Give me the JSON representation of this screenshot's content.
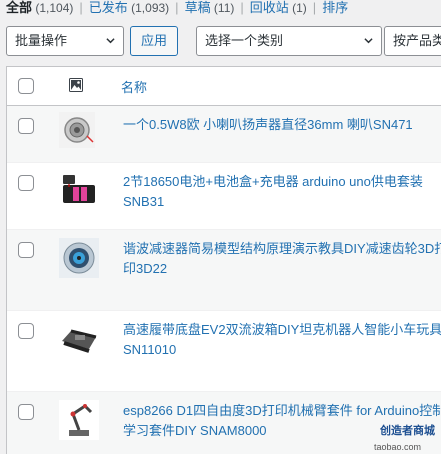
{
  "filters": [
    {
      "label": "全部",
      "count": "(1,104)",
      "current": true
    },
    {
      "label": "已发布",
      "count": "(1,093)",
      "current": false
    },
    {
      "label": "草稿",
      "count": "(11)",
      "current": false
    },
    {
      "label": "回收站",
      "count": "(1)",
      "current": false
    },
    {
      "label": "排序",
      "count": "",
      "current": false
    }
  ],
  "toolbar": {
    "bulk_actions_label": "批量操作",
    "apply_label": "应用",
    "category_label": "选择一个类别",
    "product_type_label": "按产品类"
  },
  "table": {
    "image_header_icon": "image-icon",
    "name_header": "名称"
  },
  "products": [
    {
      "title": "一个0.5W8欧 小喇叭扬声器直径36mm 喇叭SN471",
      "thumb": "speaker-thumbnail"
    },
    {
      "title": "2节18650电池+电池盒+充电器 arduino uno供电套装SNB31",
      "thumb": "battery-thumbnail"
    },
    {
      "title": "谐波减速器简易模型结构原理演示教具DIY减速齿轮3D打印3D22",
      "thumb": "gear-thumbnail"
    },
    {
      "title": "高速履带底盘EV2双流波箱DIY坦克机器人智能小车玩具SN11010",
      "thumb": "tank-chassis-thumbnail"
    },
    {
      "title": "esp8266 D1四自由度3D打印机械臂套件 for Arduino控制学习套件DIY SNAM8000",
      "thumb": "robot-arm-thumbnail"
    }
  ],
  "watermark": {
    "line1": "创造者商城",
    "line2": "taobao.com"
  }
}
